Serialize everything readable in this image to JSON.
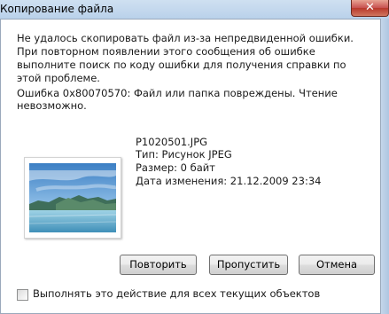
{
  "window": {
    "title": "Копирование файла",
    "close_symbol": "✕"
  },
  "message": "Не удалось скопировать файл из-за непредвиденной ошибки. При повторном появлении этого сообщения об ошибке выполните поиск по коду ошибки для получения справки по этой проблеме.",
  "error_line": "Ошибка 0x80070570: Файл или папка повреждены. Чтение невозможно.",
  "file": {
    "name": "P1020501.JPG",
    "type": "Тип: Рисунок JPEG",
    "size": "Размер: 0 байт",
    "modified": "Дата изменения: 21.12.2009 23:34"
  },
  "buttons": {
    "retry": "Повторить",
    "skip": "Пропустить",
    "cancel": "Отмена"
  },
  "checkbox": {
    "label": "Выполнять это действие для всех текущих объектов",
    "checked": false
  },
  "colors": {
    "title_bar": "#b9d1ea",
    "close_button": "#c75050"
  },
  "icons": {
    "close": "close-icon",
    "thumbnail": "landscape-thumbnail"
  }
}
